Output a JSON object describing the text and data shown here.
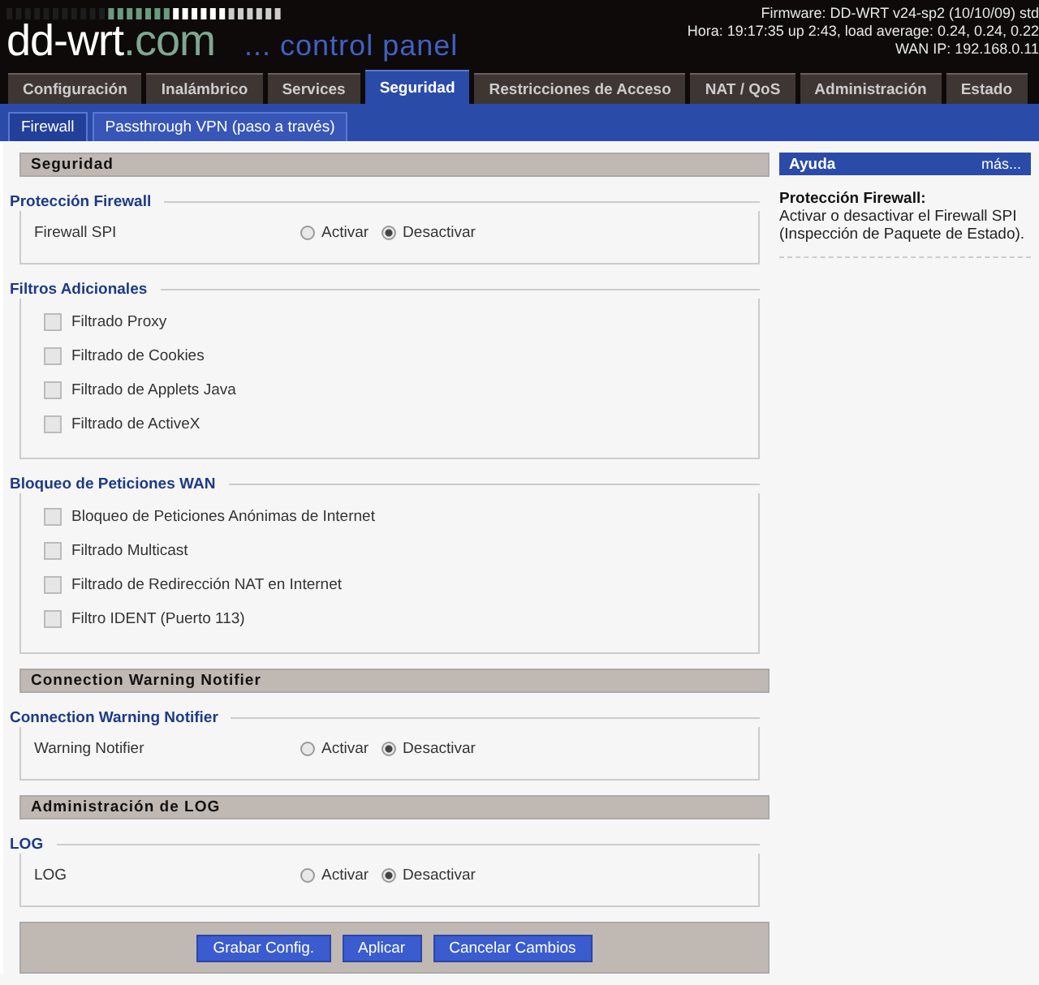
{
  "header": {
    "logo": "dd-wrt",
    "logo_suffix": ".com",
    "subtitle": "... control panel",
    "info": [
      "Firmware: DD-WRT v24-sp2 (10/10/09) std",
      "Hora: 19:17:35 up 2:43, load average: 0.24, 0.24, 0.22",
      "WAN IP: 192.168.0.11"
    ]
  },
  "tabs": [
    {
      "label": "Configuración",
      "selected": false
    },
    {
      "label": "Inalámbrico",
      "selected": false
    },
    {
      "label": "Services",
      "selected": false
    },
    {
      "label": "Seguridad",
      "selected": true
    },
    {
      "label": "Restricciones de Acceso",
      "selected": false
    },
    {
      "label": "NAT / QoS",
      "selected": false
    },
    {
      "label": "Administración",
      "selected": false
    },
    {
      "label": "Estado",
      "selected": false
    }
  ],
  "subtabs": [
    {
      "label": "Firewall",
      "selected": true
    },
    {
      "label": "Passthrough VPN (paso a través)",
      "selected": false
    }
  ],
  "sections": [
    {
      "kind": "heading",
      "title": "Seguridad"
    },
    {
      "kind": "fieldset",
      "legend": "Protección Firewall",
      "rows": [
        {
          "kind": "radio",
          "label": "Firewall SPI",
          "options": [
            {
              "label": "Activar",
              "selected": false
            },
            {
              "label": "Desactivar",
              "selected": true
            }
          ]
        }
      ]
    },
    {
      "kind": "fieldset",
      "legend": "Filtros Adicionales",
      "rows": [
        {
          "kind": "checkbox",
          "label": "Filtrado Proxy",
          "checked": false
        },
        {
          "kind": "checkbox",
          "label": "Filtrado de Cookies",
          "checked": false
        },
        {
          "kind": "checkbox",
          "label": "Filtrado de Applets Java",
          "checked": false
        },
        {
          "kind": "checkbox",
          "label": "Filtrado de ActiveX",
          "checked": false
        }
      ]
    },
    {
      "kind": "fieldset",
      "legend": "Bloqueo de Peticiones WAN",
      "rows": [
        {
          "kind": "checkbox",
          "label": "Bloqueo de Peticiones Anónimas de Internet",
          "checked": false
        },
        {
          "kind": "checkbox",
          "label": "Filtrado Multicast",
          "checked": false
        },
        {
          "kind": "checkbox",
          "label": "Filtrado de Redirección NAT en Internet",
          "checked": false
        },
        {
          "kind": "checkbox",
          "label": "Filtro IDENT (Puerto 113)",
          "checked": false
        }
      ]
    },
    {
      "kind": "heading",
      "title": "Connection Warning Notifier"
    },
    {
      "kind": "fieldset",
      "legend": "Connection Warning Notifier",
      "rows": [
        {
          "kind": "radio",
          "label": "Warning Notifier",
          "options": [
            {
              "label": "Activar",
              "selected": false
            },
            {
              "label": "Desactivar",
              "selected": true
            }
          ]
        }
      ]
    },
    {
      "kind": "heading",
      "title": "Administración de LOG"
    },
    {
      "kind": "fieldset",
      "legend": "LOG",
      "rows": [
        {
          "kind": "radio",
          "label": "LOG",
          "options": [
            {
              "label": "Activar",
              "selected": false
            },
            {
              "label": "Desactivar",
              "selected": true
            }
          ]
        }
      ]
    }
  ],
  "buttons": [
    "Grabar Config.",
    "Aplicar",
    "Cancelar Cambios"
  ],
  "help": {
    "title": "Ayuda",
    "more": "más...",
    "heading": "Protección Firewall:",
    "text": "Activar o desactivar el Firewall SPI (Inspección de Paquete de Estado)."
  }
}
